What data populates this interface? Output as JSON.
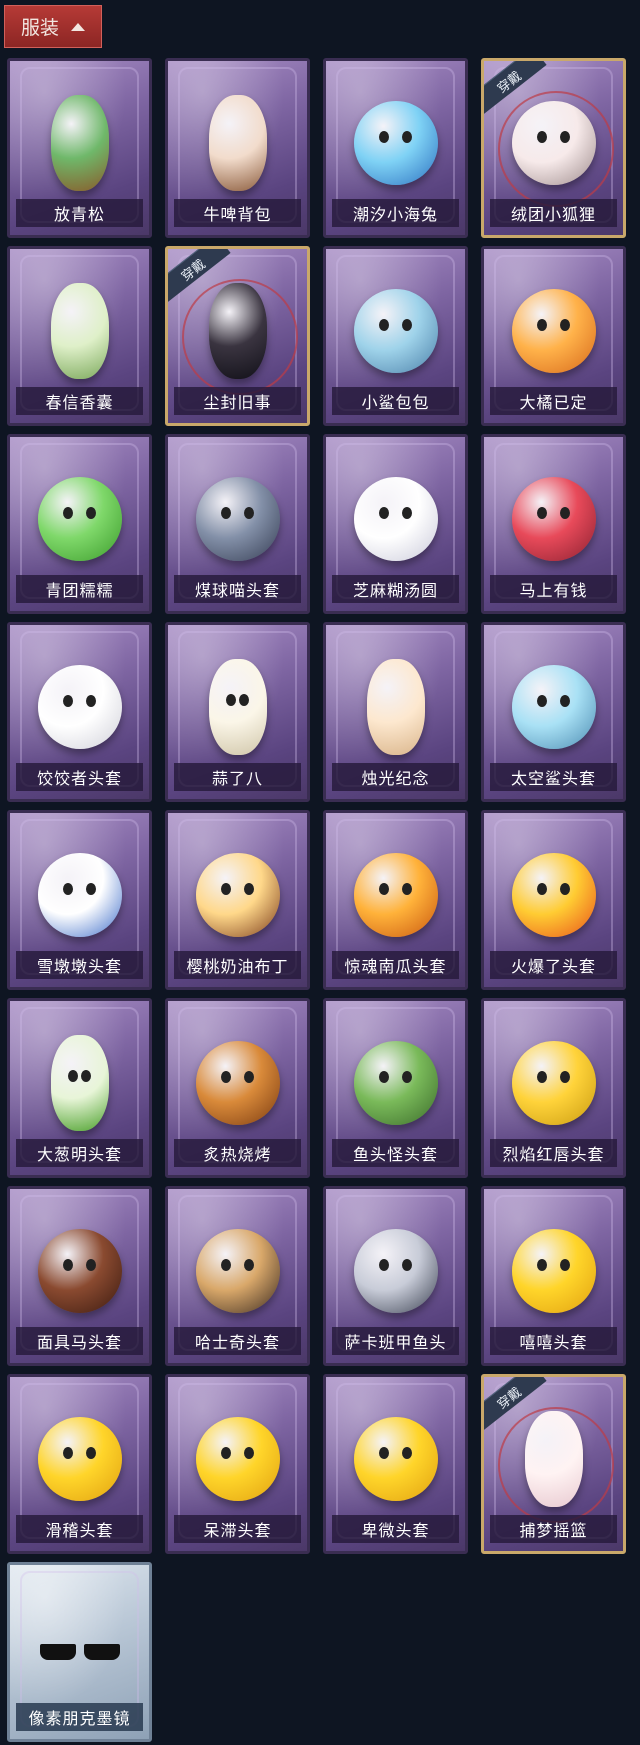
{
  "header": {
    "title": "服装"
  },
  "equipped_label": "穿戴",
  "items": [
    {
      "name": "放青松",
      "equipped": false,
      "c": "#6fb86a",
      "d": "#8a5a2a"
    },
    {
      "name": "牛啤背包",
      "equipped": false,
      "c": "#f2dccc",
      "d": "#8a5a3a"
    },
    {
      "name": "潮汐小海兔",
      "equipped": false,
      "c": "#7fd2f5",
      "d": "#2b6fbf"
    },
    {
      "name": "绒团小狐狸",
      "equipped": true,
      "c": "#f7eaea",
      "d": "#9c8a8a"
    },
    {
      "name": "春信香囊",
      "equipped": false,
      "c": "#dff0c9",
      "d": "#7aa85a"
    },
    {
      "name": "尘封旧事",
      "equipped": true,
      "c": "#3a3440",
      "d": "#111018"
    },
    {
      "name": "小鲨包包",
      "equipped": false,
      "c": "#9fd3ea",
      "d": "#4a7fa8"
    },
    {
      "name": "大橘已定",
      "equipped": false,
      "c": "#ffb24a",
      "d": "#d6681a"
    },
    {
      "name": "青团糯糯",
      "equipped": false,
      "c": "#7fd86a",
      "d": "#3a9a2a"
    },
    {
      "name": "煤球喵头套",
      "equipped": false,
      "c": "#8390a8",
      "d": "#343c52"
    },
    {
      "name": "芝麻糊汤圆",
      "equipped": false,
      "c": "#ffffff",
      "d": "#c9c9d9"
    },
    {
      "name": "马上有钱",
      "equipped": false,
      "c": "#e84a5a",
      "d": "#8a2030"
    },
    {
      "name": "饺饺者头套",
      "equipped": false,
      "c": "#ffffff",
      "d": "#cfcfd8"
    },
    {
      "name": "蒜了八",
      "equipped": false,
      "c": "#fbf6e8",
      "d": "#cfc5a8"
    },
    {
      "name": "烛光纪念",
      "equipped": false,
      "c": "#fde8cf",
      "d": "#d9b489"
    },
    {
      "name": "太空鲨头套",
      "equipped": false,
      "c": "#a9e1f5",
      "d": "#4b8ab0"
    },
    {
      "name": "雪墩墩头套",
      "equipped": false,
      "c": "#ffffff",
      "d": "#3a6bc8"
    },
    {
      "name": "樱桃奶油布丁",
      "equipped": false,
      "c": "#ffd88a",
      "d": "#7a3a1a"
    },
    {
      "name": "惊魂南瓜头套",
      "equipped": false,
      "c": "#ffb23a",
      "d": "#c8560f"
    },
    {
      "name": "火爆了头套",
      "equipped": false,
      "c": "#ffcc33",
      "d": "#e8501a"
    },
    {
      "name": "大葱明头套",
      "equipped": false,
      "c": "#e8f5d8",
      "d": "#4aa02a"
    },
    {
      "name": "炙热烧烤",
      "equipped": false,
      "c": "#d98a3a",
      "d": "#7a3a10"
    },
    {
      "name": "鱼头怪头套",
      "equipped": false,
      "c": "#7aba5a",
      "d": "#3a6a2a"
    },
    {
      "name": "烈焰红唇头套",
      "equipped": false,
      "c": "#ffd33a",
      "d": "#c89a10"
    },
    {
      "name": "面具马头套",
      "equipped": false,
      "c": "#8a4a30",
      "d": "#3a1a10"
    },
    {
      "name": "哈士奇头套",
      "equipped": false,
      "c": "#d9a86a",
      "d": "#3a2a20"
    },
    {
      "name": "萨卡班甲鱼头",
      "equipped": false,
      "c": "#c8ccd8",
      "d": "#3a4050"
    },
    {
      "name": "嘻嘻头套",
      "equipped": false,
      "c": "#ffd52a",
      "d": "#e0a010"
    },
    {
      "name": "滑稽头套",
      "equipped": false,
      "c": "#ffd52a",
      "d": "#e0a010"
    },
    {
      "name": "呆滞头套",
      "equipped": false,
      "c": "#ffd52a",
      "d": "#e0a010"
    },
    {
      "name": "卑微头套",
      "equipped": false,
      "c": "#ffd52a",
      "d": "#e0a010"
    },
    {
      "name": "捕梦摇篮",
      "equipped": true,
      "c": "#fff3f3",
      "d": "#e8c9d0"
    },
    {
      "name": "像素朋克墨镜",
      "equipped": false,
      "c": "#111111",
      "d": "#000000"
    }
  ]
}
